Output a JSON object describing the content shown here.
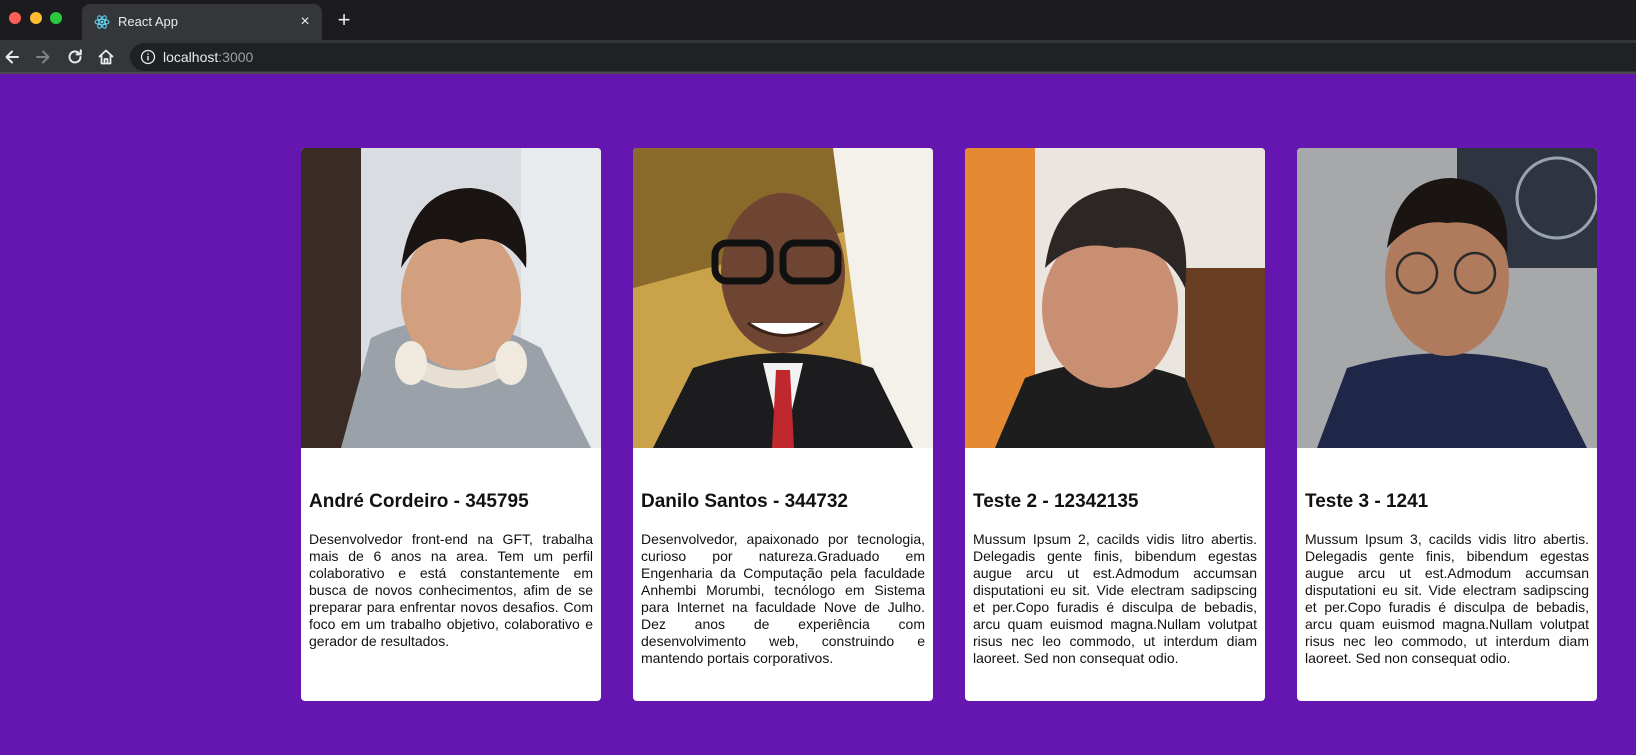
{
  "browser": {
    "tab_title": "React App",
    "url_host": "localhost",
    "url_port": ":3000",
    "new_tab_symbol": "+",
    "close_symbol": "×",
    "icons": {
      "back": "arrow-left-icon",
      "forward": "arrow-right-icon",
      "reload": "reload-icon",
      "home": "home-icon",
      "site_info": "info-icon",
      "favicon": "react-logo-icon"
    }
  },
  "theme": {
    "page_background": "#6616b0",
    "card_background": "#ffffff"
  },
  "cards": [
    {
      "title": "André Cordeiro - 345795",
      "description": "Desenvolvedor front-end na GFT, trabalha mais de 6 anos na area. Tem um perfil colaborativo e está constantemente em busca de novos conhecimentos, afim de se preparar para enfrentar novos desafios. Com foco em um trabalho objetivo, colaborativo e gerador de resultados."
    },
    {
      "title": "Danilo Santos - 344732",
      "description": "Desenvolvedor, apaixonado por tecnologia, curioso por natureza.Graduado em Engenharia da Computação pela faculdade Anhembi Morumbi, tecnólogo em Sistema para Internet na faculdade Nove de Julho. Dez anos de experiência com desenvolvimento web, construindo e mantendo portais corporativos."
    },
    {
      "title": "Teste 2 - 12342135",
      "description": "Mussum Ipsum 2, cacilds vidis litro abertis. Delegadis gente finis, bibendum egestas augue arcu ut est.Admodum accumsan disputationi eu sit. Vide electram sadipscing et per.Copo furadis é disculpa de bebadis, arcu quam euismod magna.Nullam volutpat risus nec leo commodo, ut interdum diam laoreet. Sed non consequat odio."
    },
    {
      "title": "Teste 3 - 1241",
      "description": "Mussum Ipsum 3, cacilds vidis litro abertis. Delegadis gente finis, bibendum egestas augue arcu ut est.Admodum accumsan disputationi eu sit. Vide electram sadipscing et per.Copo furadis é disculpa de bebadis, arcu quam euismod magna.Nullam volutpat risus nec leo commodo, ut interdum diam laoreet. Sed non consequat odio."
    }
  ]
}
